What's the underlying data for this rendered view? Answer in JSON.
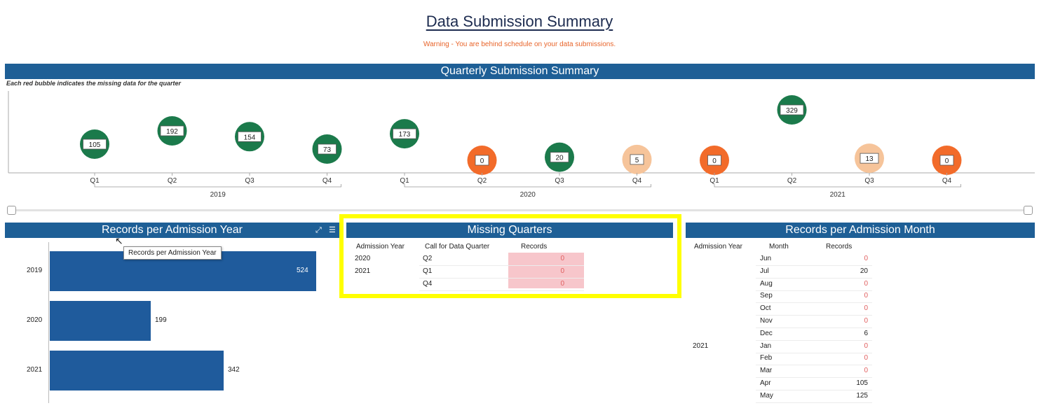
{
  "header": {
    "title": "Data Submission Summary",
    "warning": "Warning - You are behind schedule on your data submissions."
  },
  "quarterly": {
    "title": "Quarterly Submission Summary",
    "note": "Each red bubble indicates the missing data for the quarter",
    "years": [
      "2019",
      "2020",
      "2021"
    ],
    "bubbles": [
      {
        "quarter": "Q1",
        "year": "2019",
        "value": 105,
        "status": "ok"
      },
      {
        "quarter": "Q2",
        "year": "2019",
        "value": 192,
        "status": "ok"
      },
      {
        "quarter": "Q3",
        "year": "2019",
        "value": 154,
        "status": "ok"
      },
      {
        "quarter": "Q4",
        "year": "2019",
        "value": 73,
        "status": "ok"
      },
      {
        "quarter": "Q1",
        "year": "2020",
        "value": 173,
        "status": "ok"
      },
      {
        "quarter": "Q2",
        "year": "2020",
        "value": 0,
        "status": "missing"
      },
      {
        "quarter": "Q3",
        "year": "2020",
        "value": 20,
        "status": "ok"
      },
      {
        "quarter": "Q4",
        "year": "2020",
        "value": 5,
        "status": "low"
      },
      {
        "quarter": "Q1",
        "year": "2021",
        "value": 0,
        "status": "missing"
      },
      {
        "quarter": "Q2",
        "year": "2021",
        "value": 329,
        "status": "ok"
      },
      {
        "quarter": "Q3",
        "year": "2021",
        "value": 13,
        "status": "low"
      },
      {
        "quarter": "Q4",
        "year": "2021",
        "value": 0,
        "status": "missing"
      }
    ],
    "colors": {
      "ok": "#1b7a4b",
      "missing": "#f26b2a",
      "low": "#f6c49a"
    }
  },
  "admission_year": {
    "title": "Records per Admission Year",
    "tooltip": "Records per Admission Year",
    "icons": [
      "expand-icon",
      "list-icon"
    ],
    "chart_data": {
      "type": "bar",
      "categories": [
        "2019",
        "2020",
        "2021"
      ],
      "values": [
        524,
        199,
        342
      ]
    }
  },
  "missing_quarters": {
    "title": "Missing Quarters",
    "columns": [
      "Admission Year",
      "Call for Data Quarter",
      "Records"
    ],
    "rows": [
      {
        "year": "2020",
        "quarter": "Q2",
        "records": "0"
      },
      {
        "year": "2021",
        "quarter": "Q1",
        "records": "0"
      },
      {
        "year": "",
        "quarter": "Q4",
        "records": "0"
      }
    ]
  },
  "admission_month": {
    "title": "Records per Admission Month",
    "columns": [
      "Admission Year",
      "Month",
      "Records"
    ],
    "year_label": "2021",
    "rows": [
      {
        "month": "Jun",
        "records": "0"
      },
      {
        "month": "Jul",
        "records": "20"
      },
      {
        "month": "Aug",
        "records": "0"
      },
      {
        "month": "Sep",
        "records": "0"
      },
      {
        "month": "Oct",
        "records": "0"
      },
      {
        "month": "Nov",
        "records": "0"
      },
      {
        "month": "Dec",
        "records": "6"
      },
      {
        "month": "Jan",
        "records": "0"
      },
      {
        "month": "Feb",
        "records": "0"
      },
      {
        "month": "Mar",
        "records": "0"
      },
      {
        "month": "Apr",
        "records": "105"
      },
      {
        "month": "May",
        "records": "125"
      }
    ]
  }
}
